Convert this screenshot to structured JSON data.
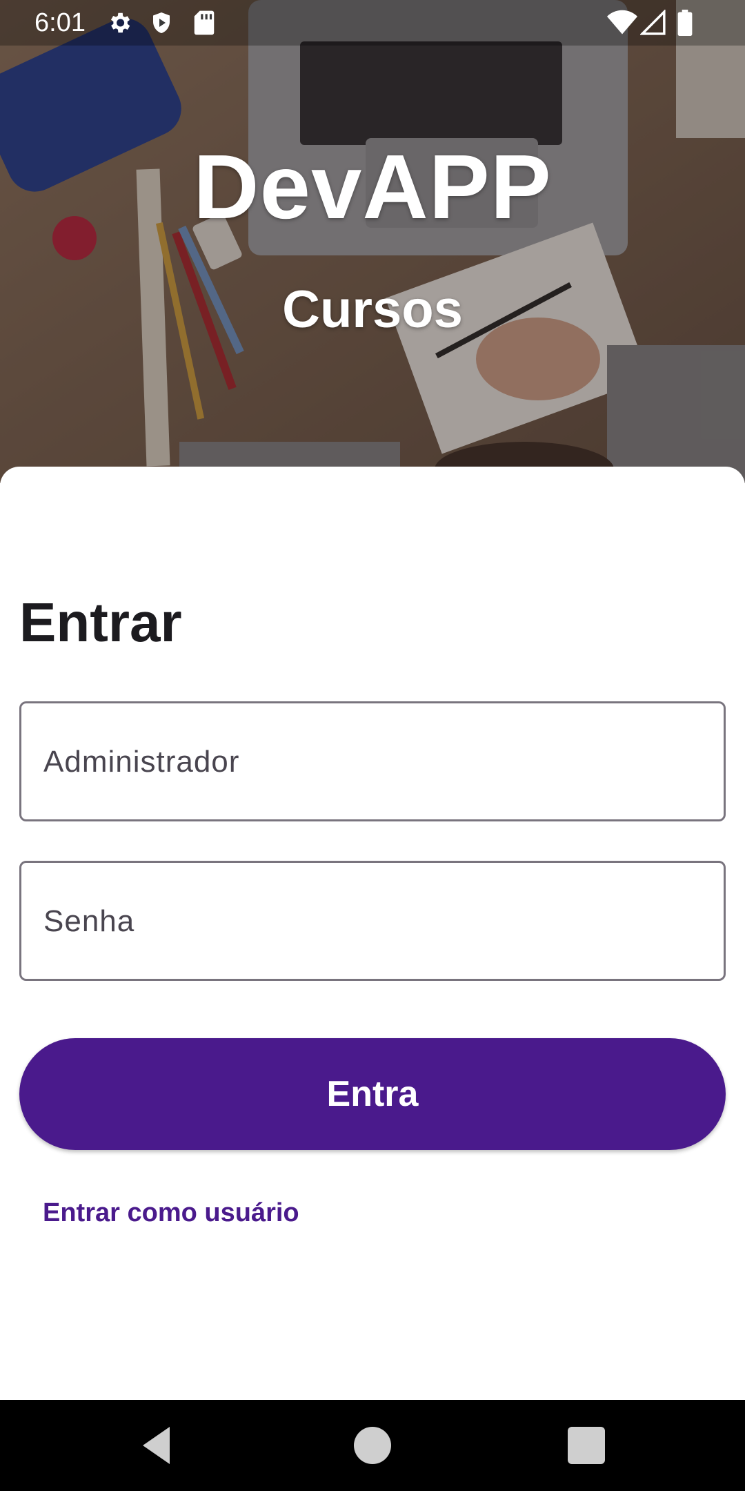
{
  "status_bar": {
    "time": "6:01",
    "icons": [
      "settings-icon",
      "shield-icon",
      "sd-card-icon",
      "wifi-icon",
      "signal-icon",
      "battery-icon"
    ]
  },
  "hero": {
    "title": "DevAPP",
    "subtitle": "Cursos",
    "background_description_icon": "desk-photo"
  },
  "login": {
    "heading": "Entrar",
    "username_placeholder": "Administrador",
    "password_placeholder": "Senha",
    "submit_label": "Entra",
    "alt_link_label": "Entrar como usuário"
  },
  "navigation": {
    "buttons": [
      "back-icon",
      "home-icon",
      "recents-icon"
    ]
  },
  "colors": {
    "accent": "#4a1a8c",
    "field_border": "#79747e",
    "heading_text": "#1c1b1f",
    "nav_background": "#000000"
  }
}
